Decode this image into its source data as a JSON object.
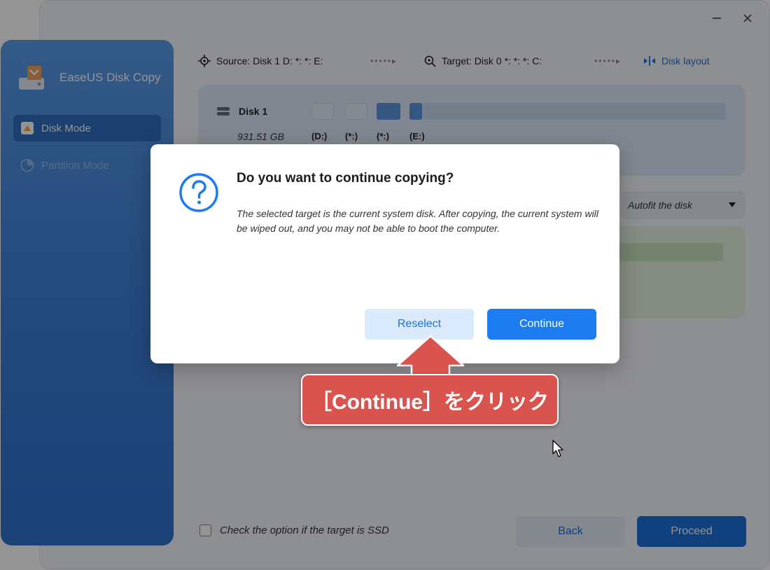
{
  "window": {
    "controls": [
      "minimize-icon",
      "close-icon"
    ]
  },
  "app": {
    "title": "EaseUS Disk Copy"
  },
  "sidebar": {
    "items": [
      {
        "label": "Disk Mode",
        "icon": "disk-icon",
        "active": true
      },
      {
        "label": "Partition Mode",
        "icon": "pie-chart-icon",
        "active": false
      }
    ]
  },
  "topbar": {
    "source": "Source: Disk 1 D: *: *: E:",
    "target": "Target: Disk 0 *: *: *: C:",
    "dots": "•••••▸",
    "disk_layout": "Disk layout"
  },
  "source_disk": {
    "name": "Disk 1",
    "size": "931.51 GB",
    "partitions": [
      "(D:)",
      "(*:)",
      "(*:)",
      "(E:)"
    ]
  },
  "target_panel": {
    "autofit": "Autofit the disk"
  },
  "footer": {
    "ssd_option": "Check the option if the target is SSD",
    "back": "Back",
    "proceed": "Proceed"
  },
  "dialog": {
    "title": "Do you want to continue copying?",
    "message": "The selected target is the current system disk. After copying, the current system will be wiped out, and you may not be able to boot the computer.",
    "reselect": "Reselect",
    "continue": "Continue"
  },
  "annotation": {
    "text": "［Continue］をクリック"
  },
  "colors": {
    "accent": "#1d7cf0",
    "callout": "#d9534f",
    "sidebar": "#3f80d9"
  }
}
